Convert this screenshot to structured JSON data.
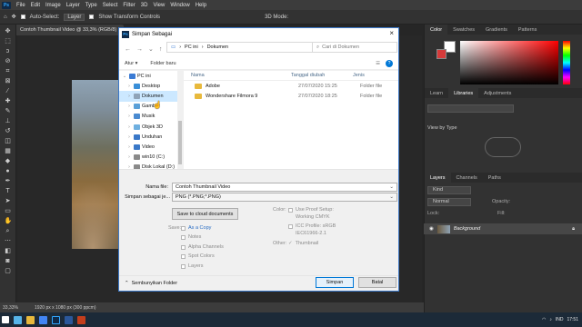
{
  "app": {
    "logo": "Ps",
    "menu": [
      "File",
      "Edit",
      "Image",
      "Layer",
      "Type",
      "Select",
      "Filter",
      "3D",
      "View",
      "Window",
      "Help"
    ]
  },
  "options": {
    "auto_select": "Auto-Select:",
    "auto_select_value": "Layer",
    "transform": "Show Transform Controls",
    "mode": "3D Mode:"
  },
  "doc_tab": "Contoh Thumbnail Video @ 33,3% (RGB/8) ×",
  "statusbar": {
    "zoom": "33,33%",
    "info": "1920 px x 1080 px (300 ppcm)"
  },
  "panels": {
    "color_tabs": [
      "Color",
      "Swatches",
      "Gradients",
      "Patterns"
    ],
    "lib_tabs": [
      "Learn",
      "Libraries",
      "Adjustments"
    ],
    "view_by": "View by Type",
    "layer_tabs": [
      "Layers",
      "Channels",
      "Paths"
    ],
    "kind": "Kind",
    "normal": "Normal",
    "opacity": "Opacity:",
    "lock": "Lock:",
    "fill": "Fill:",
    "layer_name": "Background"
  },
  "dialog": {
    "title": "Simpan Sebagai",
    "path": [
      "PC ini",
      "Dokumen"
    ],
    "search_placeholder": "Cari di Dokumen",
    "organize": "Atur ▾",
    "new_folder": "Folder baru",
    "nav_items": [
      {
        "label": "PC ini",
        "color": "#3b7bd4"
      },
      {
        "label": "Desktop",
        "color": "#3a8fd8"
      },
      {
        "label": "Dokumen",
        "color": "#8fa3b8",
        "selected": true
      },
      {
        "label": "Gambar",
        "color": "#5aa0d8"
      },
      {
        "label": "Musik",
        "color": "#4a8ad0"
      },
      {
        "label": "Objek 3D",
        "color": "#6fb0e0"
      },
      {
        "label": "Unduhan",
        "color": "#3a78c8"
      },
      {
        "label": "Video",
        "color": "#3a78c8"
      },
      {
        "label": "win10 (C:)",
        "color": "#8a8a8a"
      },
      {
        "label": "Disk Lokal (D:)",
        "color": "#8a8a8a"
      }
    ],
    "columns": {
      "name": "Nama",
      "date": "Tanggal diubah",
      "type": "Jenis"
    },
    "files": [
      {
        "name": "Adobe",
        "date": "27/07/2020 15:25",
        "type": "Folder file"
      },
      {
        "name": "Wondershare Filmora 9",
        "date": "27/07/2020 18:25",
        "type": "Folder file"
      }
    ],
    "filename_label": "Nama file:",
    "filename_value": "Contoh Thumbnail Video",
    "savetype_label": "Simpan sebagai je...",
    "savetype_value": "PNG (*.PNG;*.PNG)",
    "cloud_button": "Save to cloud documents",
    "save_label": "Save:",
    "as_copy": "As a Copy",
    "notes": "Notes",
    "alpha": "Alpha Channels",
    "spot": "Spot Colors",
    "layers": "Layers",
    "color_label": "Color:",
    "proof": "Use Proof Setup:",
    "proof_sub": "Working CMYK",
    "icc": "ICC Profile:  sRGB",
    "icc_sub": "IEC61966-2.1",
    "other_label": "Other:",
    "thumbnail": "Thumbnail",
    "hide_folders": "Sembunyikan Folder",
    "save_btn": "Simpan",
    "cancel_btn": "Batal"
  },
  "taskbar": {
    "lang": "IND",
    "time": "17:51"
  }
}
